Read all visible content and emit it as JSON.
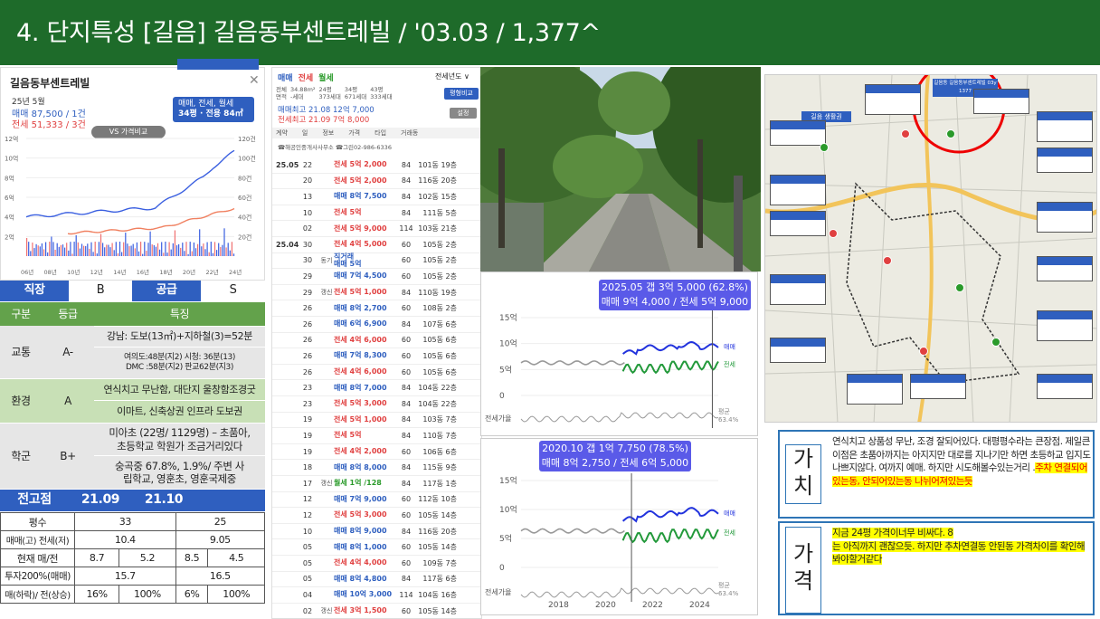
{
  "title": "4. 단지특성 [길음] 길음동부센트레빌 / '03.03 / 1,377^",
  "left": {
    "app_name": "길음동부센트레빌",
    "date": "25년 5월",
    "sale_line": "매매 87,500 / 1건",
    "jeonse_line": "전세 51,333 / 3건",
    "filter_line1": "매매, 전세, 월세",
    "filter_line2": "34평 · 전용 84㎡",
    "compare_btn": "VS 가격비교",
    "y_left": [
      "12억",
      "10억",
      "8억",
      "6억",
      "4억",
      "2억"
    ],
    "y_right": [
      "120건",
      "100건",
      "80건",
      "60건",
      "40건",
      "20건"
    ],
    "x_ticks": [
      "06년",
      "08년",
      "10년",
      "12년",
      "14년",
      "16년",
      "18년",
      "20년",
      "22년",
      "24년"
    ],
    "grade_row": {
      "a": "직장",
      "b": "B",
      "c": "공급",
      "d": "S"
    },
    "grade_header": {
      "a": "구분",
      "b": "등급",
      "c": "특징"
    },
    "traffic": {
      "label": "교통",
      "grade": "A-",
      "f1": "강남: 도보(13㎡)+지하철(3)=52분",
      "f2": "여의도:48분(지2) 시청: 36분(13)\nDMC :58분(지2) 판교62분(지3)"
    },
    "env": {
      "label": "환경",
      "grade": "A",
      "f1": "연식치고 무난함, 대단지 울창함조경굿",
      "f2": "이마트, 신축상권 인프라 도보권"
    },
    "school": {
      "label": "학군",
      "grade": "B+",
      "f1": "미아초 (22명/ 1129명) – 초품아,\n초등학교 학원가 조금거리있다",
      "f2": "숭곡중 67.8%, 1.9%/ 주변 사\n립학교, 영훈초, 영훈국제중"
    },
    "peak": {
      "label": "전고점",
      "v1": "21.09",
      "v2": "21.10"
    },
    "table": {
      "h": [
        "평수",
        "33",
        "25"
      ],
      "r1": [
        "매매(고) 전세(저)",
        "10.4",
        "9.05"
      ],
      "r2": [
        "현재 매/전",
        "8.7",
        "5.2",
        "8.5",
        "4.5"
      ],
      "r3": [
        "투자200%(매매)",
        "15.7",
        "16.5"
      ],
      "r4": [
        "매(하락)/ 전(상승)",
        "16%",
        "100%",
        "6%",
        "100%"
      ]
    }
  },
  "mid": {
    "tabs": [
      "매매",
      "전세",
      "월세"
    ],
    "year_sel": "전세년도 ∨",
    "area_tabs": [
      "전체\n면적",
      "34.88m²\n-세대",
      "24평\n373세대",
      "34평\n671세대",
      "43평\n333세대"
    ],
    "compare_btn": "평형비교",
    "high1": "매매최고 21.08  12억 7,000",
    "high2": "전세최고 21.09  7억 8,000",
    "set_btn": "설정",
    "col_hdr": [
      "계약",
      "일",
      "정보",
      "가격",
      "타입",
      "거래동"
    ],
    "agent": "☎해공인중개사사무소   ☎그린02-986-6336",
    "rows": [
      [
        "25.05",
        "22",
        "",
        "전세 5억 2,000",
        "84",
        "101동 19층",
        "#e04040"
      ],
      [
        "",
        "20",
        "",
        "전세 5억 2,000",
        "84",
        "116동 20층",
        "#e04040"
      ],
      [
        "",
        "13",
        "",
        "매매 8억 7,500",
        "84",
        "102동 15층",
        "#2f5fbf"
      ],
      [
        "",
        "10",
        "",
        "전세 5억",
        "84",
        "111동 5층",
        "#e04040"
      ],
      [
        "",
        "02",
        "",
        "전세 5억 9,000",
        "114",
        "103동 21층",
        "#e04040"
      ],
      [
        "25.04",
        "30",
        "",
        "전세 4억 5,000",
        "60",
        "105동 2층",
        "#e04040"
      ],
      [
        "",
        "30",
        "동기",
        "직거래\n매매 5억",
        "60",
        "105동 2층",
        "#2f5fbf"
      ],
      [
        "",
        "29",
        "",
        "매매 7억 4,500",
        "60",
        "105동 2층",
        "#2f5fbf"
      ],
      [
        "",
        "29",
        "갱신",
        "전세 5억 1,000",
        "84",
        "110동 19층",
        "#e04040"
      ],
      [
        "",
        "26",
        "",
        "매매 8억 2,700",
        "60",
        "108동 2층",
        "#2f5fbf"
      ],
      [
        "",
        "26",
        "",
        "매매 6억 6,900",
        "84",
        "107동 6층",
        "#2f5fbf"
      ],
      [
        "",
        "26",
        "",
        "전세 4억 6,000",
        "60",
        "105동 6층",
        "#e04040"
      ],
      [
        "",
        "26",
        "",
        "매매 7억 8,300",
        "60",
        "105동 6층",
        "#2f5fbf"
      ],
      [
        "",
        "26",
        "",
        "전세 4억 6,000",
        "60",
        "105동 6층",
        "#e04040"
      ],
      [
        "",
        "23",
        "",
        "매매 8억 7,000",
        "84",
        "104동 22층",
        "#2f5fbf"
      ],
      [
        "",
        "23",
        "",
        "전세 5억 3,000",
        "84",
        "104동 22층",
        "#e04040"
      ],
      [
        "",
        "19",
        "",
        "전세 5억 1,000",
        "84",
        "103동 7층",
        "#e04040"
      ],
      [
        "",
        "19",
        "",
        "전세 5억",
        "84",
        "110동 7층",
        "#e04040"
      ],
      [
        "",
        "19",
        "",
        "전세 4억 2,000",
        "60",
        "106동 6층",
        "#e04040"
      ],
      [
        "",
        "18",
        "",
        "매매 8억 8,000",
        "84",
        "115동 9층",
        "#2f5fbf"
      ],
      [
        "",
        "17",
        "갱신",
        "월세 1억 /128",
        "84",
        "117동 1층",
        "#2a9a2a"
      ],
      [
        "",
        "12",
        "",
        "매매 7억 9,000",
        "60",
        "112동 10층",
        "#2f5fbf"
      ],
      [
        "",
        "12",
        "",
        "전세 5억 3,000",
        "60",
        "105동 14층",
        "#e04040"
      ],
      [
        "",
        "10",
        "",
        "매매 8억 9,000",
        "84",
        "116동 20층",
        "#2f5fbf"
      ],
      [
        "",
        "05",
        "",
        "매매 8억 1,000",
        "60",
        "105동 14층",
        "#2f5fbf"
      ],
      [
        "",
        "05",
        "",
        "전세 4억 4,000",
        "60",
        "109동 7층",
        "#e04040"
      ],
      [
        "",
        "05",
        "",
        "매매 8억 4,800",
        "84",
        "117동 6층",
        "#2f5fbf"
      ],
      [
        "",
        "04",
        "",
        "매매 10억 3,000",
        "114",
        "104동 16층",
        "#2f5fbf"
      ],
      [
        "",
        "02",
        "갱신",
        "전세 3억 1,500",
        "60",
        "105동 14층",
        "#e04040"
      ]
    ]
  },
  "chart1": {
    "tip1": "2025.05  갭 3억 5,000 (62.8%)",
    "tip2": "매매 9억 4,000 / 전세 5억 9,000",
    "y": [
      "15억",
      "10억",
      "5억",
      "0"
    ],
    "ratio_label": "전세가율",
    "avg": "평균\n63.4%",
    "s1": "매매",
    "s2": "전세"
  },
  "chart2": {
    "tip1": "2020.10  갭 1억 7,750 (78.5%)",
    "tip2": "매매 8억 2,750 / 전세 6억 5,000",
    "y": [
      "15억",
      "10억",
      "5억",
      "0"
    ],
    "ratio_label": "전세가율",
    "avg": "평균\n63.4%",
    "s1": "매매",
    "s2": "전세",
    "x": [
      "2018",
      "2020",
      "2022",
      "2024"
    ]
  },
  "map": {
    "label": "길음 생활권",
    "top_label": "길음동 길음동부센트레빌 03y 1377"
  },
  "notes": {
    "value_tag": "가\n치",
    "value_text1": "연식치고 상품성 무난, 조경 잘되어있다. 대평평수라는 큰장점. 제일큰 이점은 초품아까지는 아지지만 대로를 지나기만 하면 초등하교 입지도 나쁘지않다. 여까지 예매. 하지만 시도해볼수있는거리 .",
    "value_text2": "주차 연결되어있는동, 안되어있는동 나뉘어져있는듯",
    "price_tag": "가\n격",
    "price_text1": "지금 24평 가격이너무 비싸다. 8",
    "price_text2": "는 아직까지 괜찮으듯. 하지만 추차연결동 안된동 가격차이를 확인해봐야할거같다"
  },
  "colors": {
    "title_bg": "#1e6b2a",
    "blue": "#2f5fbf",
    "sale": "#2233dd",
    "jeonse": "#22993a",
    "note_border": "#2e75b6"
  }
}
